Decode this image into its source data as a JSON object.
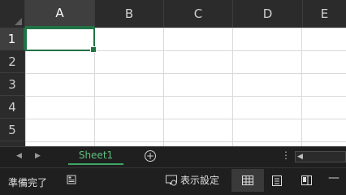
{
  "columns": [
    "A",
    "B",
    "C",
    "D",
    "E"
  ],
  "rows": [
    "1",
    "2",
    "3",
    "4",
    "5"
  ],
  "active_cell": "A1",
  "sheet_tabs": [
    {
      "label": "Sheet1",
      "active": true
    }
  ],
  "status": {
    "ready_label": "準備完了",
    "display_settings_label": "表示設定"
  },
  "colors": {
    "accent": "#217346",
    "tab_text": "#5fbf7f",
    "background": "#1f1f1f",
    "header_bg": "#2b2b2b",
    "grid_line": "#d9d9d9"
  },
  "icons": {
    "nav_prev": "triangle-left-icon",
    "nav_next": "triangle-right-icon",
    "add_sheet": "plus-circle-icon",
    "more": "vertical-dots-icon",
    "accessibility": "accessibility-icon",
    "display_settings": "display-settings-icon",
    "normal_view": "grid-view-icon",
    "page_layout": "page-layout-icon",
    "page_break": "page-break-preview-icon",
    "zoom_out": "minus-icon"
  }
}
